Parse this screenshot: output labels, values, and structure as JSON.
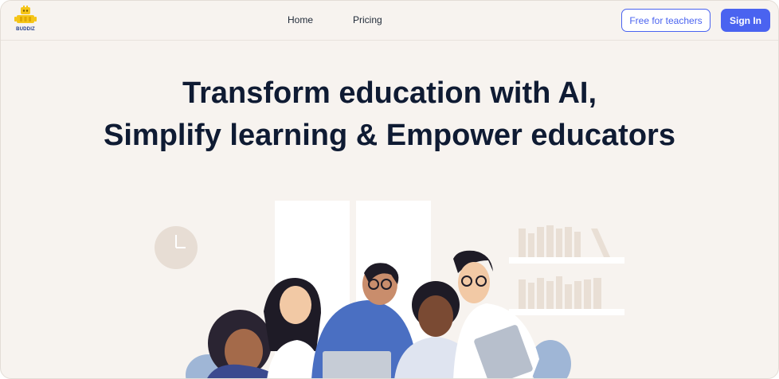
{
  "brand": {
    "name": "BUDDIZ",
    "logo_icon": "robot-stack-logo",
    "color": "#f5c518"
  },
  "nav": {
    "links": [
      {
        "label": "Home"
      },
      {
        "label": "Pricing"
      }
    ],
    "free_button": "Free for teachers",
    "signin_button": "Sign In"
  },
  "hero": {
    "line1": "Transform education with AI,",
    "line2": "Simplify learning & Empower educators"
  },
  "colors": {
    "accent": "#4a63f0",
    "background": "#f7f3ef",
    "heading": "#0f1b33"
  }
}
